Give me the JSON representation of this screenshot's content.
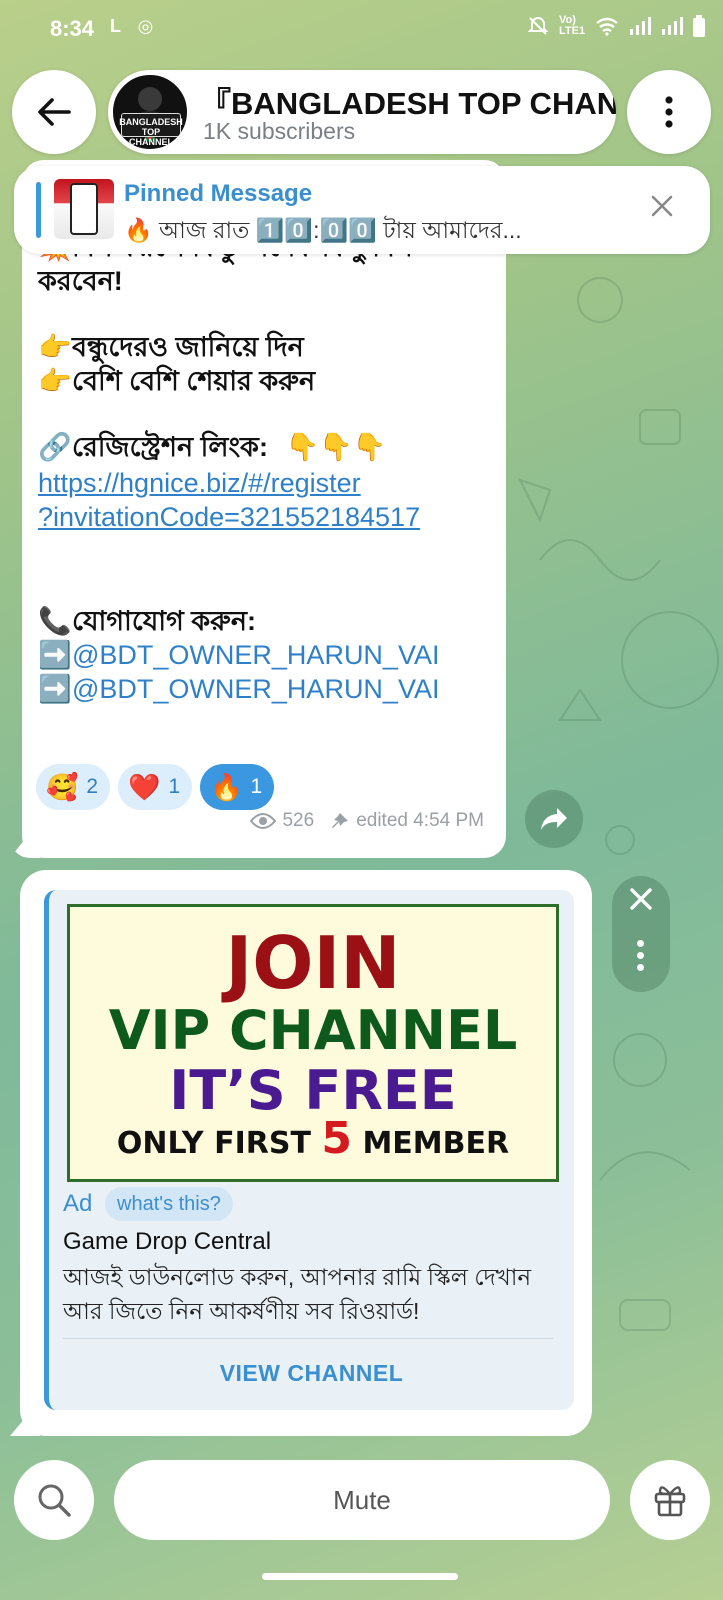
{
  "status_bar": {
    "time": "8:34",
    "left_icons": "L ◎",
    "network": "Vo) LTE1",
    "battery": "▮"
  },
  "header": {
    "channel_title": "『BANGLADESH TOP CHANNEL",
    "subscribers": "1K subscribers",
    "avatar_text": "BANGLADESH TOP CHANNEL"
  },
  "pinned": {
    "title": "Pinned Message",
    "preview": "🔥 আজ রাত 1️⃣0️⃣:0️⃣0️⃣ টায়  আমাদের..."
  },
  "message": {
    "line_partial": "⁉️ ...",
    "line1": "মিস করলে কিন্তু অনেক কিছু মিস",
    "line1_emoji": "💥",
    "line2": "করবেন!",
    "line3": "বন্ধুদেরও জানিয়ে দিন",
    "line4": "বেশি বেশি শেয়ার করুন",
    "pointer_emoji": "👉",
    "reg_label": "রেজিস্ট্রেশন লিংক:",
    "reg_emoji": "🔗",
    "reg_points": "👇👇👇",
    "link_line1": "https://hgnice.biz/#/register",
    "link_line2": "?invitationCode=321552184517",
    "contact_label": "যোগাযোগ করুন:",
    "contact_emoji": "📞",
    "arrow_emoji": "➡️",
    "mention1": "@BDT_OWNER_HARUN_VAI",
    "mention2": "@BDT_OWNER_HARUN_VAI",
    "reactions": [
      {
        "emoji": "🥰",
        "count": "2"
      },
      {
        "emoji": "❤️",
        "count": "1"
      },
      {
        "emoji": "🔥",
        "count": "1"
      }
    ],
    "views": "526",
    "edited": "edited 4:54 PM"
  },
  "ad": {
    "image_line1": "JOIN",
    "image_line2": "VIP CHANNEL",
    "image_line3": "IT’S FREE",
    "image_line4a": "ONLY FIRST ",
    "image_line4b": "5",
    "image_line4c": " MEMBER",
    "label": "Ad",
    "whats_this": "what's this?",
    "name": "Game Drop Central",
    "description": "আজই ডাউনলোড করুন, আপনার রামি স্কিল দেখান আর জিতে নিন আকর্ষণীয় সব রিওয়ার্ড!",
    "cta": "VIEW CHANNEL",
    "colors": {
      "join": "#9b1015",
      "vip": "#0d5a1c",
      "free": "#4a1a91",
      "five": "#d41a1f"
    }
  },
  "bottom_bar": {
    "mute_label": "Mute"
  }
}
